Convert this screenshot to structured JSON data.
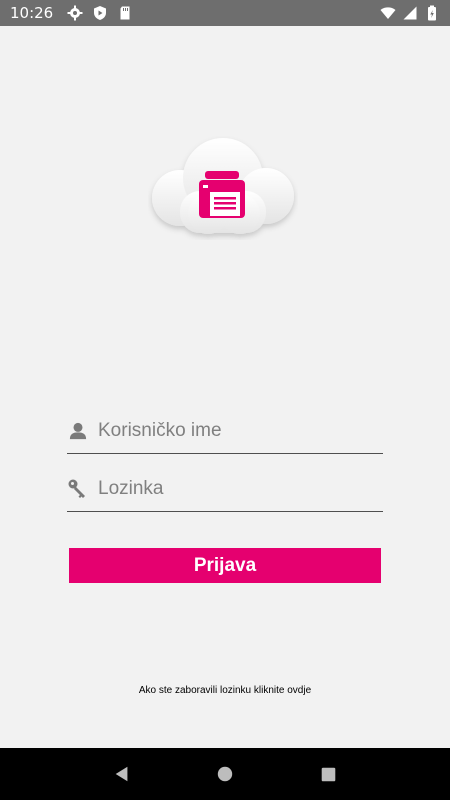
{
  "status_bar": {
    "time": "10:26",
    "left_icons": [
      "gear-icon",
      "shield-play-icon",
      "sd-card-icon"
    ],
    "right_icons": [
      "wifi-icon",
      "signal-icon",
      "battery-icon"
    ]
  },
  "logo": {
    "icon": "cloud-fax-icon",
    "accent_color": "#e5006f"
  },
  "login_form": {
    "username": {
      "icon": "user-icon",
      "placeholder": "Korisničko ime",
      "value": ""
    },
    "password": {
      "icon": "key-icon",
      "placeholder": "Lozinka",
      "value": ""
    },
    "submit_label": "Prijava"
  },
  "forgot_password_text": "Ako ste zaboravili lozinku kliknite ovdje",
  "nav_bar": {
    "buttons": [
      "back-icon",
      "home-icon",
      "recents-icon"
    ]
  },
  "colors": {
    "accent": "#e5006f",
    "background": "#f2f2f2",
    "status_bar": "#6e6e6e",
    "nav_bar": "#000000"
  }
}
